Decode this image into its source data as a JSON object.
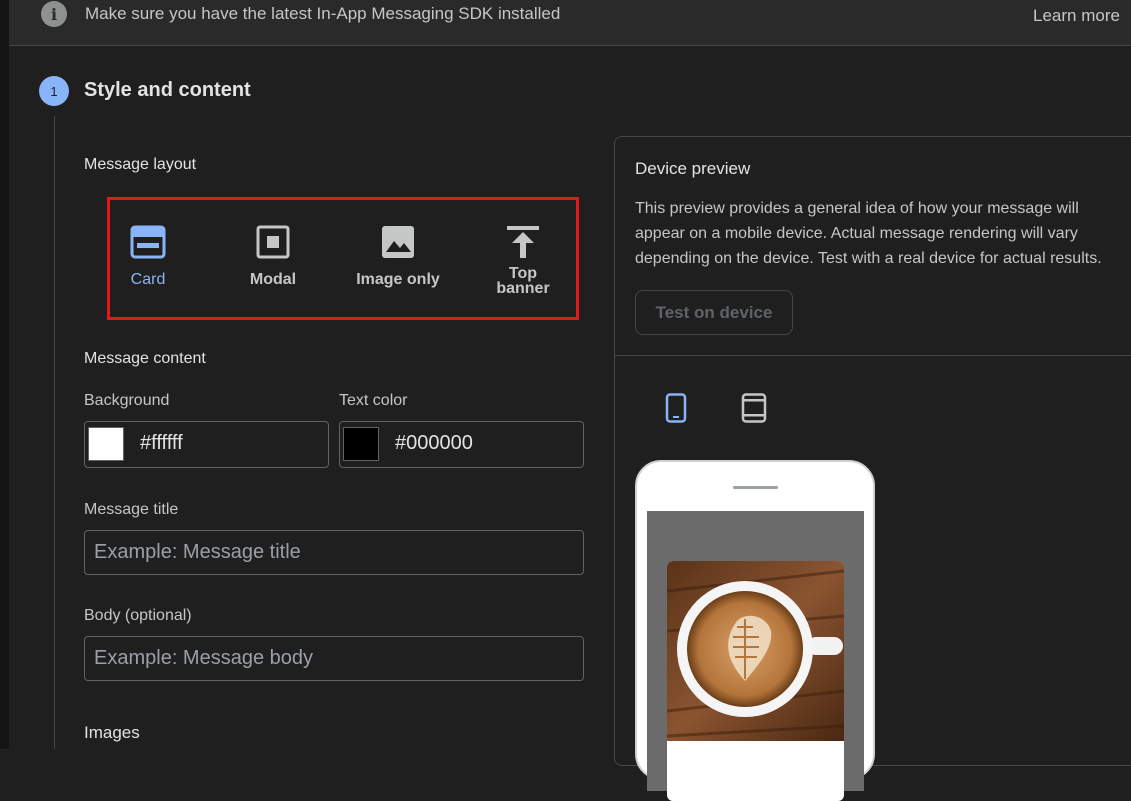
{
  "banner": {
    "message": "Make sure you have the latest In-App Messaging SDK installed",
    "learn_more": "Learn more"
  },
  "step": {
    "number": "1",
    "title": "Style and content"
  },
  "layout": {
    "label": "Message layout",
    "options": [
      {
        "label": "Card",
        "icon": "card-icon",
        "selected": true
      },
      {
        "label": "Modal",
        "icon": "modal-icon",
        "selected": false
      },
      {
        "label": "Image only",
        "icon": "image-icon",
        "selected": false
      },
      {
        "label": "Top\nbanner",
        "icon": "top-banner-icon",
        "selected": false
      }
    ]
  },
  "content": {
    "label": "Message content",
    "background_label": "Background",
    "background_value": "#ffffff",
    "text_color_label": "Text color",
    "text_color_value": "#000000",
    "title_label": "Message title",
    "title_placeholder": "Example: Message title",
    "body_label": "Body (optional)",
    "body_placeholder": "Example: Message body",
    "images_label": "Images"
  },
  "preview": {
    "title": "Device preview",
    "description": "This preview provides a general idea of how your message will appear on a mobile device. Actual message rendering will vary depending on the device. Test with a real device for actual results.",
    "test_button": "Test on device",
    "devices": [
      "phone-icon",
      "tablet-icon"
    ]
  },
  "colors": {
    "accent": "#8ab4f8",
    "highlight_border": "#e31919",
    "background": "#1f1f1f"
  }
}
